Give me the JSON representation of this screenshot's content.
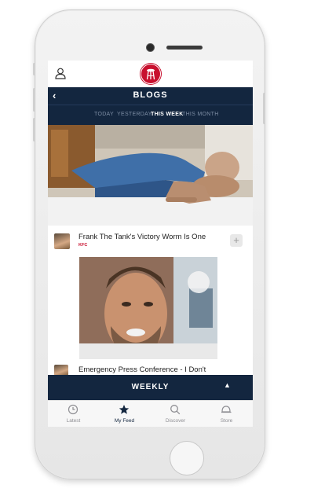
{
  "header": {
    "logo_label": "BARSTOOL"
  },
  "blogs_bar": {
    "title": "BLOGS",
    "back_icon": "chevron-left-icon"
  },
  "tabs": [
    {
      "label": "TODAY"
    },
    {
      "label": "YESTERDAY"
    },
    {
      "label": "THIS WEEK",
      "active": true
    },
    {
      "label": "THIS MONTH"
    }
  ],
  "posts": [
    {
      "title": "Frank The Tank's Victory Worm Is One",
      "tag": "KFC"
    },
    {
      "title": "Emergency Press Conference - I Don't",
      "tag": ""
    }
  ],
  "mini_player": {
    "title": "WEEKLY"
  },
  "tabbar": [
    {
      "label": "Latest",
      "icon": "clock-icon"
    },
    {
      "label": "My Feed",
      "icon": "star-icon",
      "active": true
    },
    {
      "label": "Discover",
      "icon": "search-icon"
    },
    {
      "label": "Store",
      "icon": "hat-icon"
    }
  ],
  "colors": {
    "navy": "#13263f",
    "accent_red": "#c8102e"
  }
}
